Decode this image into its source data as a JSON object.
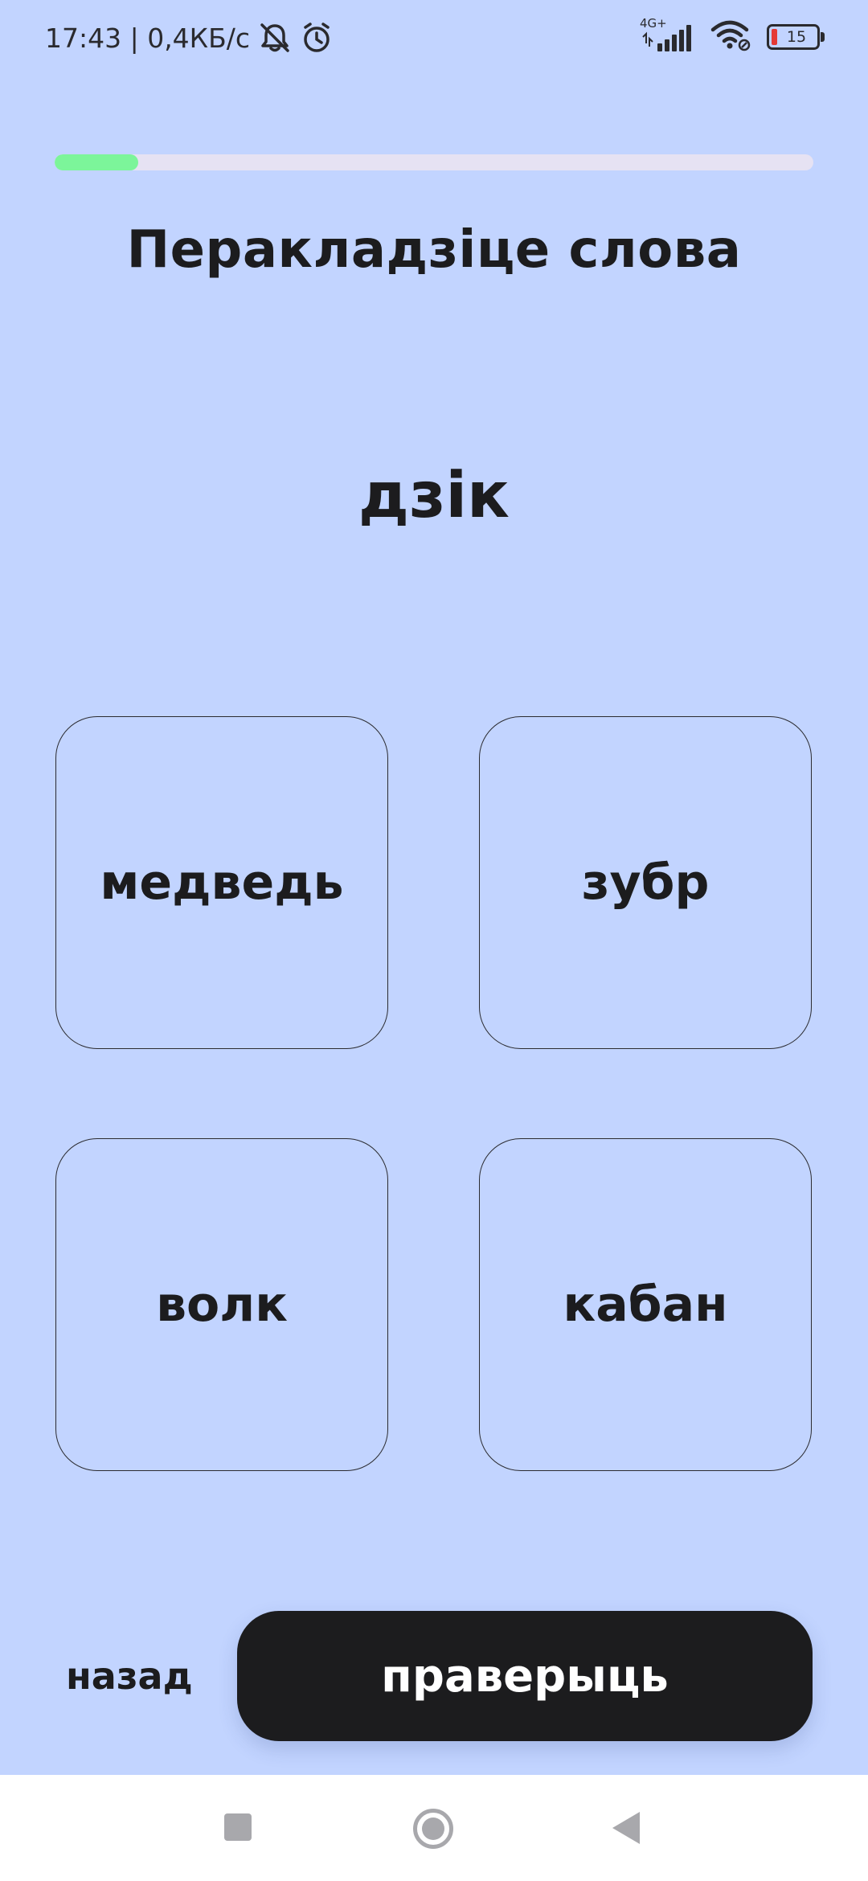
{
  "status_bar": {
    "time_speed": "17:43 | 0,4КБ/с",
    "network_type": "4G+",
    "battery_level": "15",
    "icons": [
      "bell-muted-icon",
      "alarm-icon",
      "signal-icon",
      "wifi-icon",
      "battery-icon"
    ]
  },
  "progress": {
    "fraction": 0.11,
    "fill_color": "#7cf59a",
    "track_color": "#e6e2f3"
  },
  "exercise": {
    "title": "Перакладзіце слова",
    "word": "дзік",
    "options": [
      {
        "label": "медведь"
      },
      {
        "label": "зубр"
      },
      {
        "label": "волк"
      },
      {
        "label": "кабан"
      }
    ]
  },
  "footer": {
    "back_label": "назад",
    "check_label": "праверыць"
  },
  "nav_bar": {
    "icons": [
      "recents-square-icon",
      "home-circle-icon",
      "back-triangle-icon"
    ]
  },
  "colors": {
    "background": "#c2d4ff",
    "text": "#1c1c1e",
    "button": "#1c1c1e"
  }
}
